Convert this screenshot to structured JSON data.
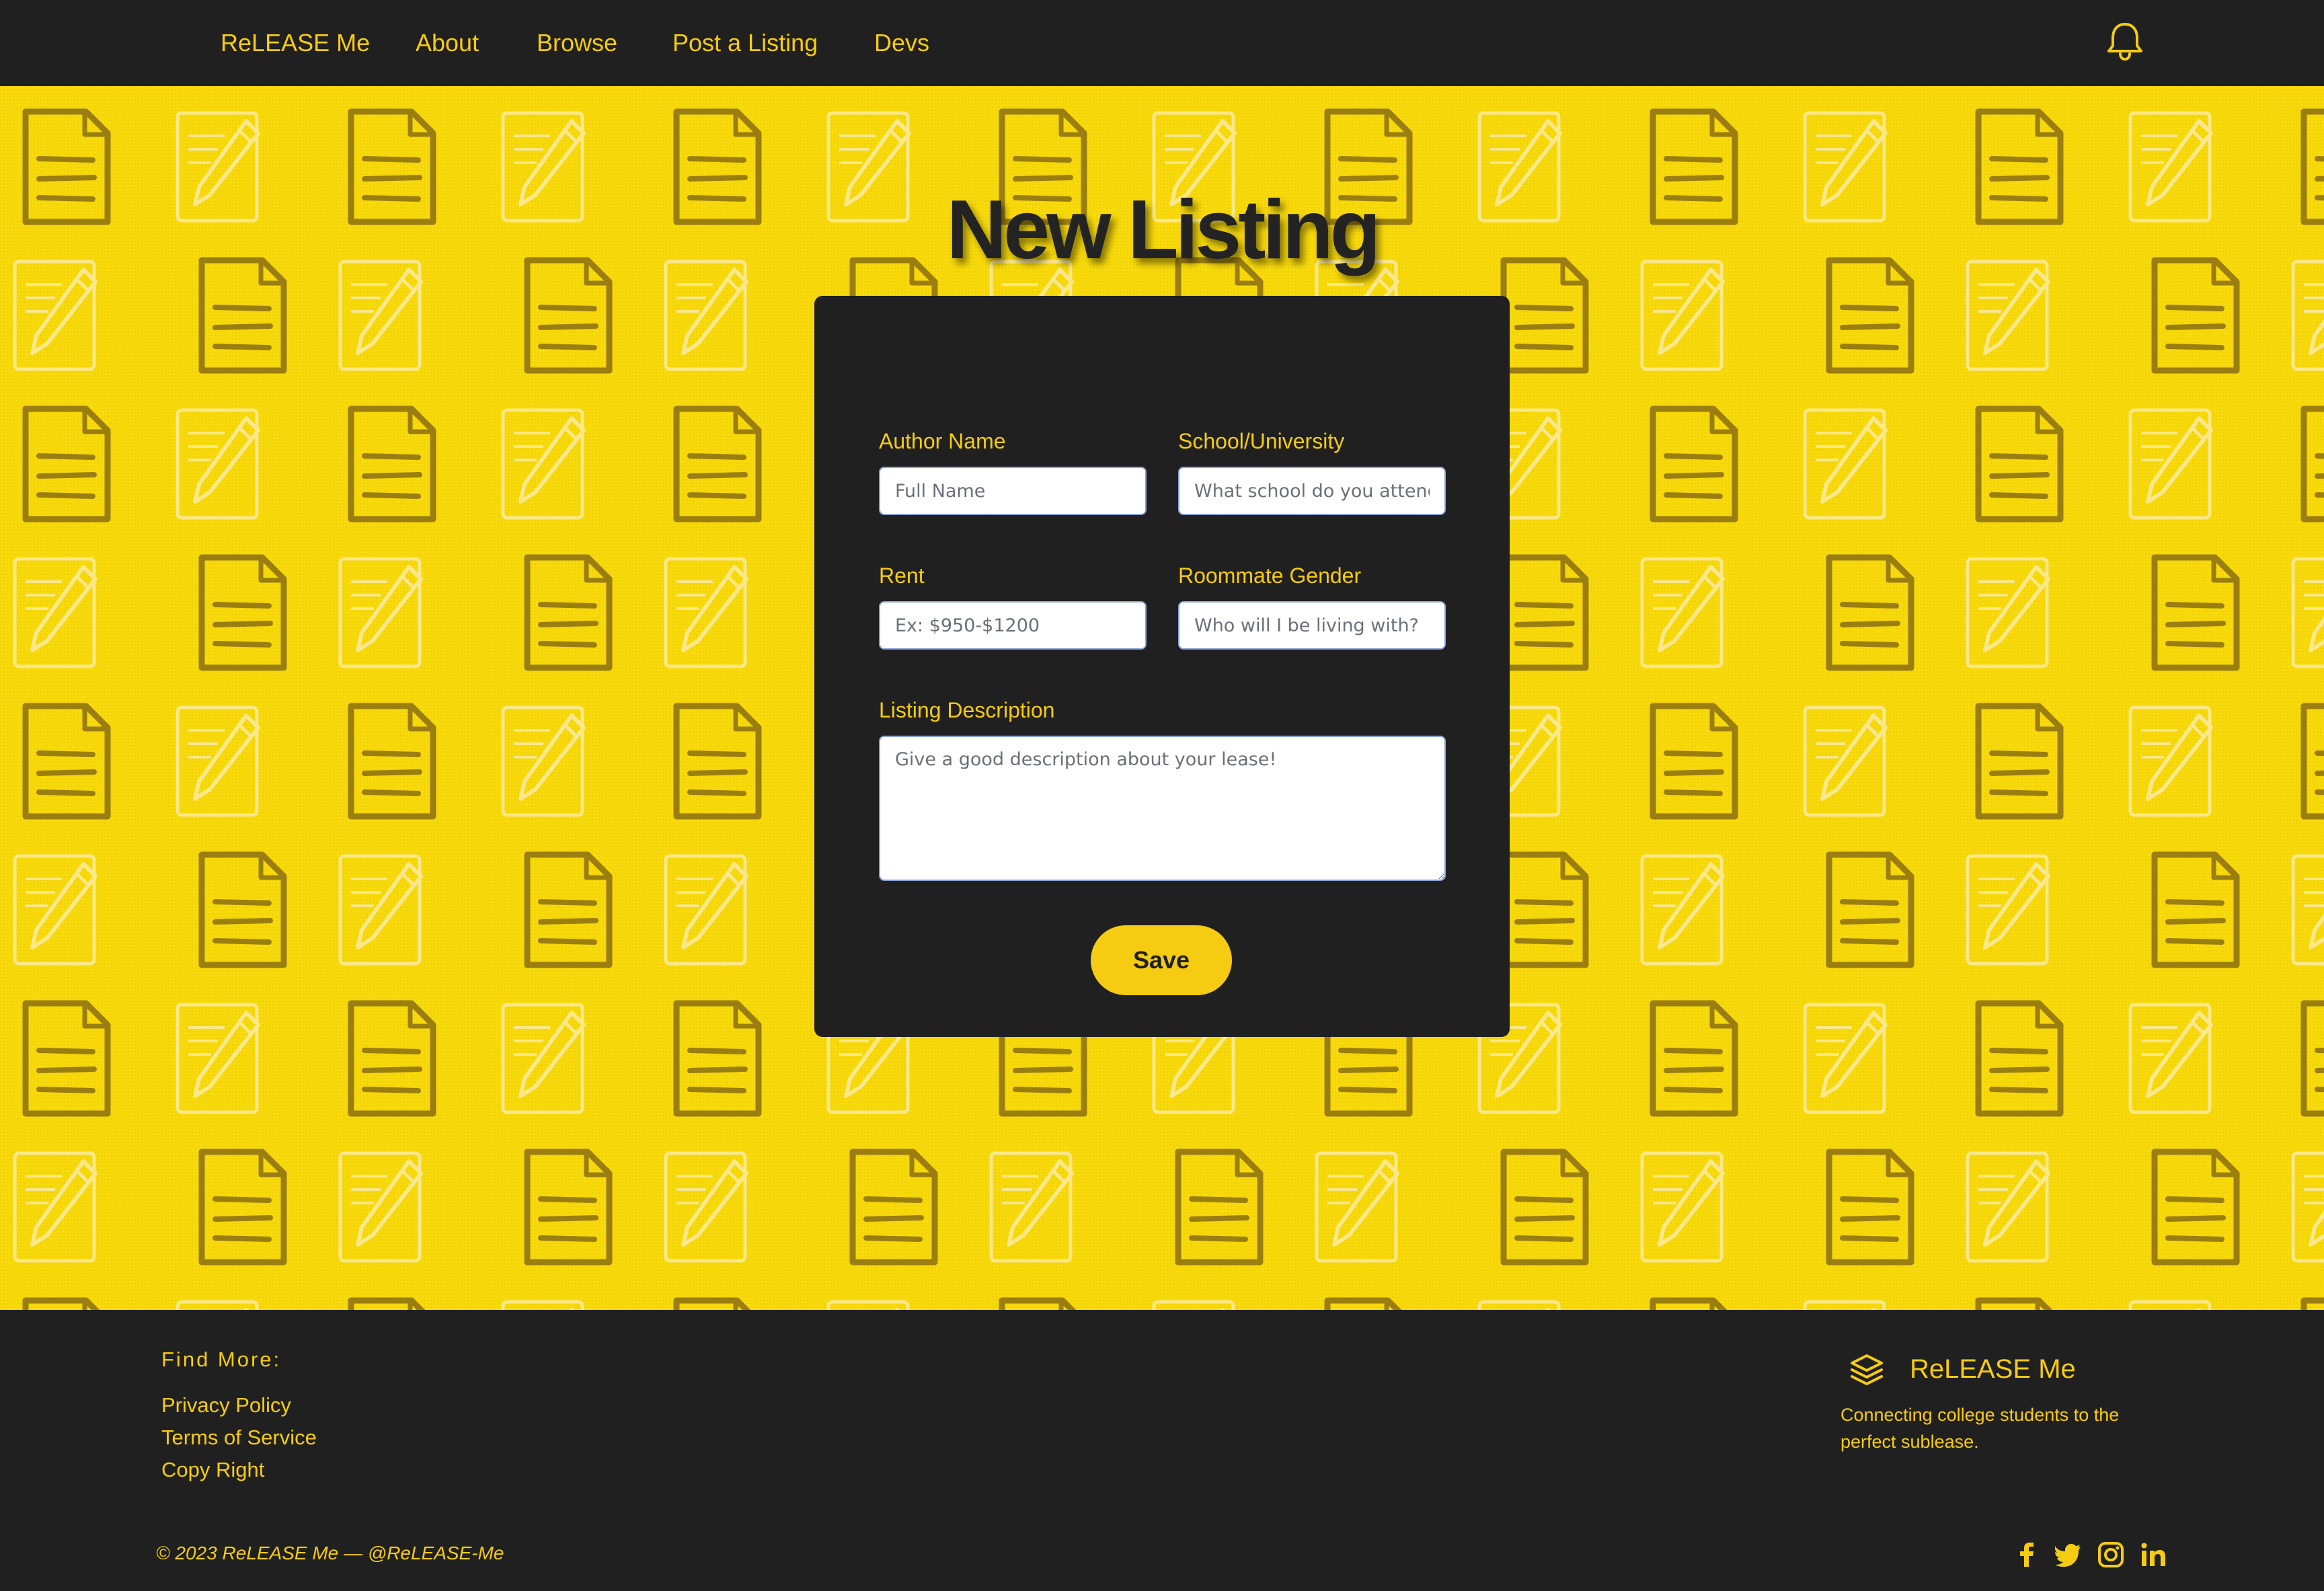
{
  "nav": {
    "brand": "ReLEASE Me",
    "links": [
      "About",
      "Browse",
      "Post a Listing",
      "Devs"
    ],
    "notification_icon": "bell-icon"
  },
  "page_title": "New Listing",
  "form": {
    "author": {
      "label": "Author Name",
      "placeholder": "Full Name"
    },
    "school": {
      "label": "School/University",
      "placeholder": "What school do you attend?"
    },
    "rent": {
      "label": "Rent",
      "placeholder": "Ex: $950-$1200"
    },
    "gender": {
      "label": "Roommate Gender",
      "placeholder": "Who will I be living with?"
    },
    "description": {
      "label": "Listing Description",
      "placeholder": "Give a good description about your lease!"
    },
    "save_label": "Save"
  },
  "footer": {
    "heading": "Find More:",
    "links": [
      "Privacy Policy",
      "Terms of Service",
      "Copy Right"
    ],
    "brand_icon": "layers-icon",
    "brand_name": "ReLEASE Me",
    "tagline": "Connecting college students to the perfect sublease.",
    "copyright": "© 2023 ReLEASE Me — @ReLEASE-Me",
    "social_icons": [
      "facebook-icon",
      "twitter-icon",
      "instagram-icon",
      "linkedin-icon"
    ]
  },
  "colors": {
    "accent": "#f6cc13",
    "background_dark": "#202020",
    "hero_yellow": "#f7d90c"
  }
}
